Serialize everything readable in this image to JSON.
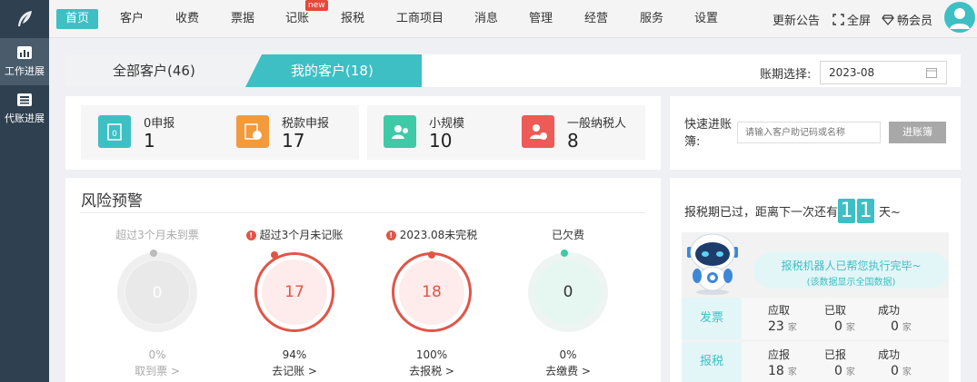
{
  "nav": {
    "items": [
      "首页",
      "客户",
      "收费",
      "票据",
      "记账",
      "报税",
      "工商项目",
      "消息",
      "管理",
      "经营",
      "服务",
      "设置"
    ],
    "new_badge": "new",
    "announcement": "更新公告",
    "fullscreen": "全屏",
    "vip": "畅会员"
  },
  "sidebar": {
    "items": [
      {
        "label": "工作进展",
        "icon": "chart-icon"
      },
      {
        "label": "代账进展",
        "icon": "list-icon"
      }
    ]
  },
  "tabs": {
    "all": "全部客户(46)",
    "mine": "我的客户(18)"
  },
  "period": {
    "label": "账期选择:",
    "value": "2023-08"
  },
  "stats": [
    {
      "label": "0申报",
      "value": "1",
      "color": "#3dbfc4",
      "icon": "zero-declare-icon"
    },
    {
      "label": "税款申报",
      "value": "17",
      "color": "#f39a3b",
      "icon": "tax-declare-icon"
    },
    {
      "label": "小规模",
      "value": "10",
      "color": "#3ec9a7",
      "icon": "small-scale-icon"
    },
    {
      "label": "一般纳税人",
      "value": "8",
      "color": "#ee5a55",
      "icon": "general-taxpayer-icon"
    }
  ],
  "quick": {
    "label": "快速进账簿:",
    "placeholder": "请输入客户助记码或名称",
    "button": "进账簿"
  },
  "risk": {
    "title": "风险预警",
    "items": [
      {
        "label": "超过3个月未到票",
        "value": "0",
        "pct": "0%",
        "link": "取到票 >",
        "warn": false,
        "percent": 0,
        "state": "inactive"
      },
      {
        "label": "超过3个月未记账",
        "value": "17",
        "pct": "94%",
        "link": "去记账 >",
        "warn": true,
        "percent": 94,
        "state": "alert"
      },
      {
        "label": "2023.08未完税",
        "value": "18",
        "pct": "100%",
        "link": "去报税 >",
        "warn": true,
        "percent": 100,
        "state": "alert"
      },
      {
        "label": "已欠费",
        "value": "0",
        "pct": "0%",
        "link": "去缴费 >",
        "warn": false,
        "percent": 0,
        "state": "ok"
      }
    ]
  },
  "countdown": {
    "prefix": "报税期已过，距离下一次还有",
    "digits": [
      "1",
      "1"
    ],
    "suffix": "天~"
  },
  "robot": {
    "line1": "报税机器人已帮您执行完毕~",
    "line2": "(该数据显示全国数据)"
  },
  "robot_table": [
    {
      "tag": "发票",
      "headers": [
        "应取",
        "已取",
        "成功"
      ],
      "values": [
        "23",
        "0",
        "0"
      ],
      "unit": "家"
    },
    {
      "tag": "报税",
      "headers": [
        "应报",
        "已报",
        "成功"
      ],
      "values": [
        "18",
        "0",
        "0"
      ],
      "unit": "家"
    }
  ]
}
